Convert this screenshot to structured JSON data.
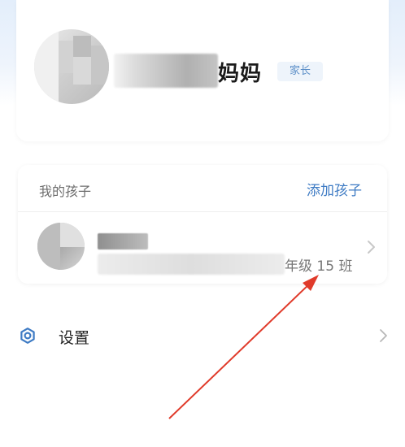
{
  "profile": {
    "name_suffix": "妈妈",
    "role_badge": "家长"
  },
  "children_section": {
    "title": "我的孩子",
    "add_child_label": "添加孩子",
    "children": [
      {
        "class_label": "年级 15 班"
      }
    ]
  },
  "settings": {
    "label": "设置",
    "icon": "gear-icon"
  },
  "colors": {
    "accent": "#3e7bc4",
    "badge_bg": "#eef4fb",
    "badge_text": "#5c8fc8",
    "annotation_arrow": "#e03a2a"
  }
}
